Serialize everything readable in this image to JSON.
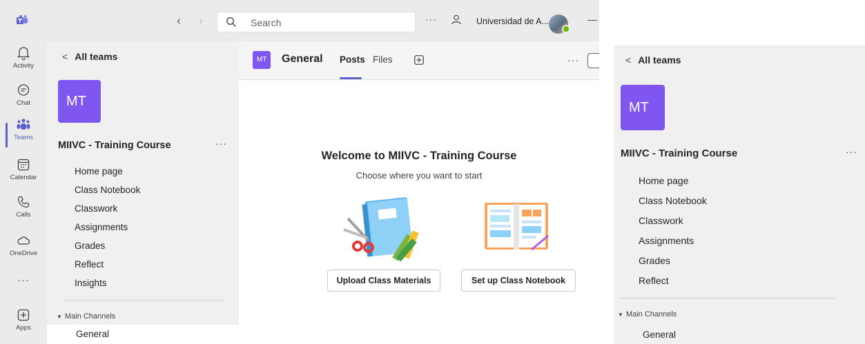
{
  "titlebar": {
    "search_placeholder": "Search",
    "org_name": "Universidad de A...",
    "back_glyph": "‹",
    "forward_glyph": "›"
  },
  "rail": {
    "items": [
      {
        "label": "Activity",
        "icon": "bell-icon"
      },
      {
        "label": "Chat",
        "icon": "chat-icon"
      },
      {
        "label": "Teams",
        "icon": "teams-icon",
        "active": true
      },
      {
        "label": "Calendar",
        "icon": "calendar-icon"
      },
      {
        "label": "Calls",
        "icon": "phone-icon"
      },
      {
        "label": "OneDrive",
        "icon": "cloud-icon"
      },
      {
        "label": "",
        "icon": "more-icon"
      },
      {
        "label": "Apps",
        "icon": "apps-icon"
      }
    ],
    "more_glyph": "···"
  },
  "team_panel": {
    "back_label": "All teams",
    "team_initials": "MT",
    "team_name": "MIIVC - Training Course",
    "nav_items": [
      "Home page",
      "Class Notebook",
      "Classwork",
      "Assignments",
      "Grades",
      "Reflect",
      "Insights"
    ],
    "section_label": "Main Channels",
    "channels": [
      "General"
    ]
  },
  "channel": {
    "initials": "MT",
    "name": "General",
    "tabs": [
      "Posts",
      "Files"
    ],
    "active_tab": "Posts"
  },
  "welcome": {
    "title": "Welcome to MIIVC - Training Course",
    "subtitle": "Choose where you want to start",
    "buttons": [
      "Upload Class Materials",
      "Set up Class Notebook"
    ]
  },
  "zoom_panel": {
    "back_label": "All teams",
    "team_initials": "MT",
    "team_name": "MIIVC - Training Course",
    "nav_items": [
      "Home page",
      "Class Notebook",
      "Classwork",
      "Assignments",
      "Grades",
      "Reflect"
    ],
    "section_label": "Main Channels",
    "channels": [
      "General"
    ]
  },
  "colors": {
    "accent": "#5b5fc7",
    "team_tile": "#7f56f0",
    "presence": "#6bb700"
  }
}
